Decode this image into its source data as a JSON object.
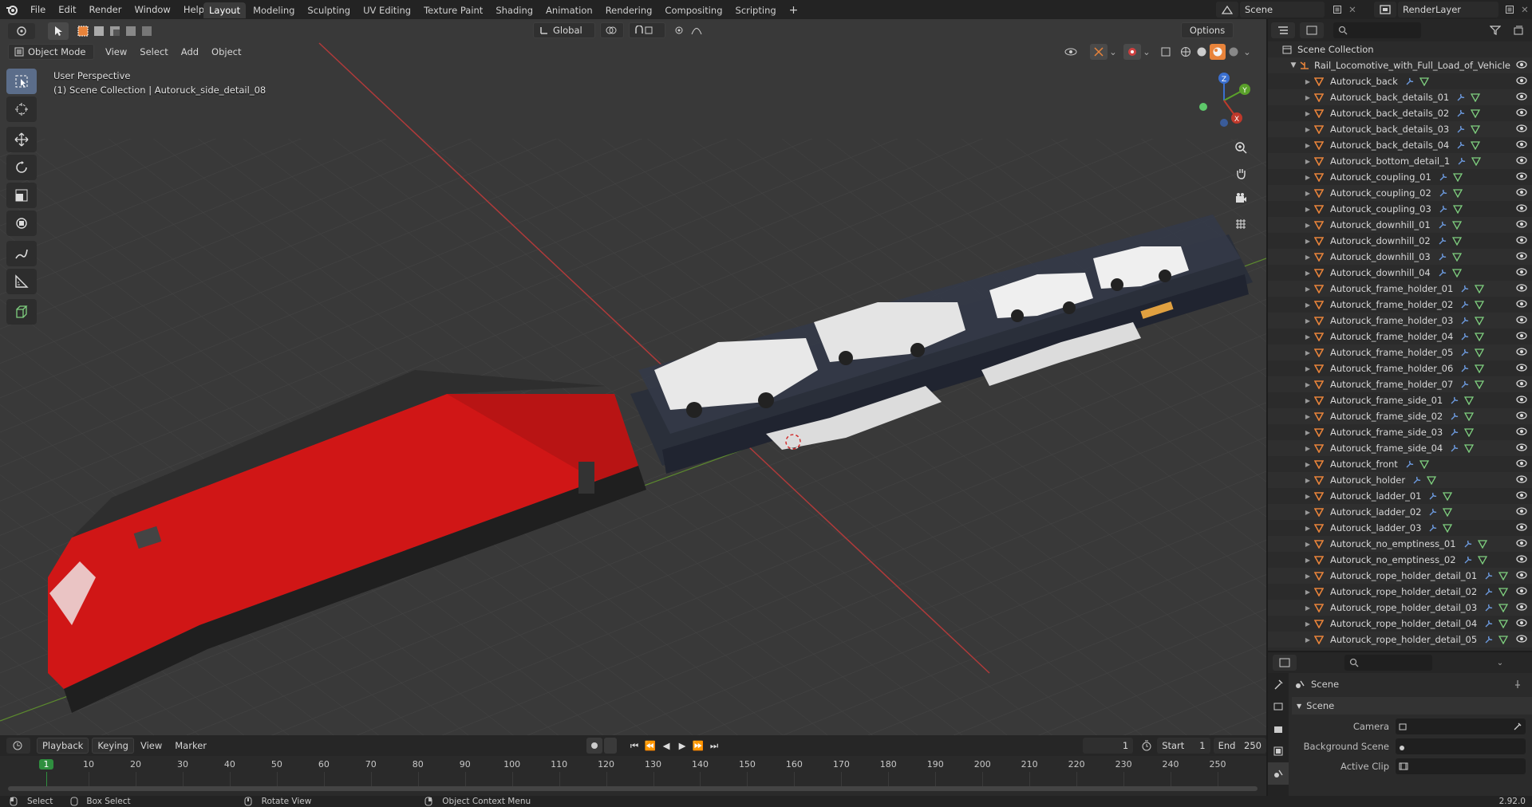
{
  "app": {
    "menus": [
      "File",
      "Edit",
      "Render",
      "Window",
      "Help"
    ],
    "workspaces": [
      "Layout",
      "Modeling",
      "Sculpting",
      "UV Editing",
      "Texture Paint",
      "Shading",
      "Animation",
      "Rendering",
      "Compositing",
      "Scripting"
    ],
    "active_workspace": "Layout",
    "scene_name": "Scene",
    "render_layer": "RenderLayer"
  },
  "viewport": {
    "transform_orientation": "Global",
    "options_label": "Options",
    "mode": "Object Mode",
    "header_menus": [
      "View",
      "Select",
      "Add",
      "Object"
    ],
    "perspective_label": "User Perspective",
    "collection_info": "(1) Scene Collection | Autoruck_side_detail_08",
    "gizmo_axes": {
      "x": "X",
      "y": "Y",
      "z": "Z"
    }
  },
  "outliner": {
    "root": "Scene Collection",
    "collection": "Rail_Locomotive_with_Full_Load_of_Vehicle",
    "items": [
      "Autoruck_back",
      "Autoruck_back_details_01",
      "Autoruck_back_details_02",
      "Autoruck_back_details_03",
      "Autoruck_back_details_04",
      "Autoruck_bottom_detail_1",
      "Autoruck_coupling_01",
      "Autoruck_coupling_02",
      "Autoruck_coupling_03",
      "Autoruck_downhill_01",
      "Autoruck_downhill_02",
      "Autoruck_downhill_03",
      "Autoruck_downhill_04",
      "Autoruck_frame_holder_01",
      "Autoruck_frame_holder_02",
      "Autoruck_frame_holder_03",
      "Autoruck_frame_holder_04",
      "Autoruck_frame_holder_05",
      "Autoruck_frame_holder_06",
      "Autoruck_frame_holder_07",
      "Autoruck_frame_side_01",
      "Autoruck_frame_side_02",
      "Autoruck_frame_side_03",
      "Autoruck_frame_side_04",
      "Autoruck_front",
      "Autoruck_holder",
      "Autoruck_ladder_01",
      "Autoruck_ladder_02",
      "Autoruck_ladder_03",
      "Autoruck_no_emptiness_01",
      "Autoruck_no_emptiness_02",
      "Autoruck_rope_holder_detail_01",
      "Autoruck_rope_holder_detail_02",
      "Autoruck_rope_holder_detail_03",
      "Autoruck_rope_holder_detail_04",
      "Autoruck_rope_holder_detail_05"
    ]
  },
  "properties": {
    "breadcrumb": "Scene",
    "panel_title": "Scene",
    "fields": [
      {
        "label": "Camera",
        "value": ""
      },
      {
        "label": "Background Scene",
        "value": ""
      },
      {
        "label": "Active Clip",
        "value": ""
      }
    ]
  },
  "timeline": {
    "menus": [
      "Playback",
      "Keying",
      "View",
      "Marker"
    ],
    "current_frame": "1",
    "start_label": "Start",
    "start": "1",
    "end_label": "End",
    "end": "250",
    "ticks": [
      "1",
      "10",
      "20",
      "30",
      "40",
      "50",
      "60",
      "70",
      "80",
      "90",
      "100",
      "110",
      "120",
      "130",
      "140",
      "150",
      "160",
      "170",
      "180",
      "190",
      "200",
      "210",
      "220",
      "230",
      "240",
      "250"
    ]
  },
  "status": {
    "select": "Select",
    "box_select": "Box Select",
    "rotate_view": "Rotate View",
    "context_menu": "Object Context Menu",
    "version": "2.92.0"
  },
  "colors": {
    "accent_orange": "#e8833a",
    "active_blue": "#5b6d8a",
    "locomotive_red": "#d01616",
    "axis_red": "#c0392b",
    "axis_green": "#5aa12a"
  }
}
